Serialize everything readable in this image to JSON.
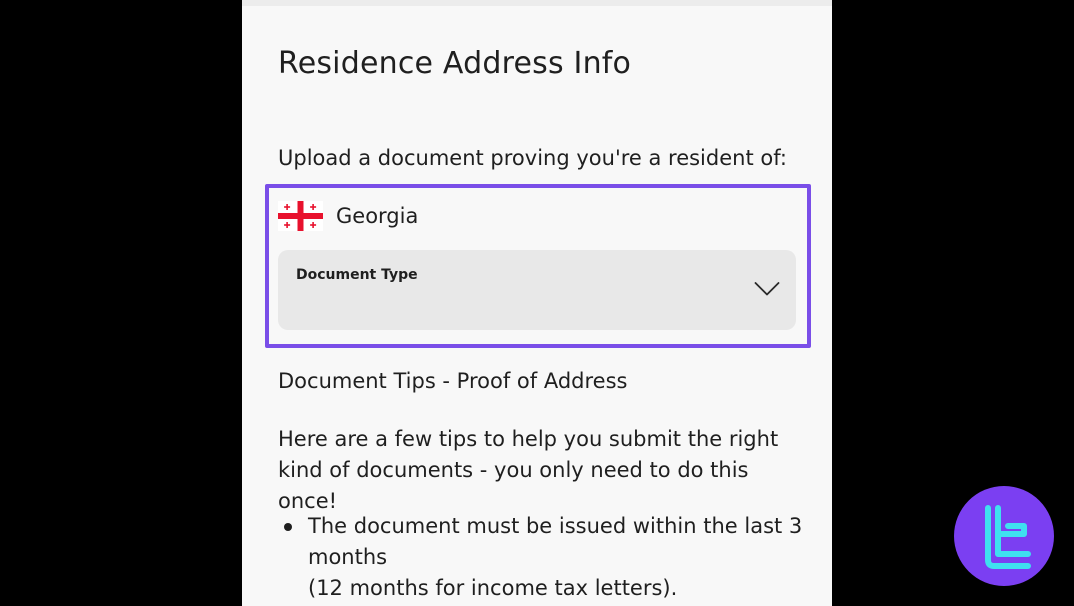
{
  "form": {
    "title": "Residence Address Info",
    "upload_prompt": "Upload a document proving you're a resident of:",
    "country": {
      "name": "Georgia",
      "flag_icon": "georgia-flag-icon"
    },
    "document_type": {
      "label": "Document Type",
      "value": "",
      "icon": "chevron-down-icon"
    },
    "highlight_color": "#7a4ee8"
  },
  "tips": {
    "title": "Document Tips - Proof of Address",
    "intro": "Here are a few tips to help you submit the right kind of documents - you only need to do this once!",
    "items": [
      {
        "line1": "The document must be issued within the last 3 months",
        "line2": "(12 months for income tax letters)."
      }
    ]
  },
  "brand": {
    "logo_icon": "tc-logo-icon",
    "logo_bg": "#7b3ff2",
    "logo_fg": "#3fe0f0"
  }
}
